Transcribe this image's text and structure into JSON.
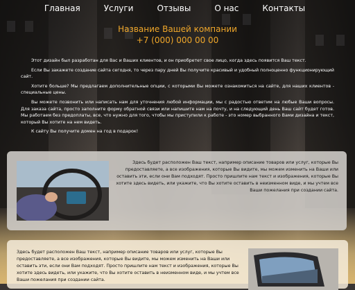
{
  "nav": {
    "items": [
      {
        "label": "Главная"
      },
      {
        "label": "Услуги"
      },
      {
        "label": "Отзывы"
      },
      {
        "label": "О нас"
      },
      {
        "label": "Контакты"
      }
    ]
  },
  "header": {
    "company_name": "Название Вашей компании",
    "phone": "+7 (000) 000 00 00"
  },
  "intro": {
    "paragraphs": [
      "Этот дизайн был разработан для Вас и Ваших клиентов, и он приобретет свое лицо, когда здесь появится Ваш текст.",
      "Если Вы закажете создание сайта сегодня, то через пару дней Вы получите красивый и удобный полноценно функционирующий сайт.",
      "Хотите больше? Мы предлагаем дополнительные опции, с которыми Вы можете ознакомиться на сайте, для наших клиентов - специальные цены.",
      "Вы можете позвонить или написать нам для уточнения любой информации, мы с радостью ответим на любые Ваши вопросы. Для заказа сайта, просто заполните форму обратной связи или напишите нам на почту, и на следующий день Ваш сайт будет готов. Мы работаем без предоплаты, все, что нужно для того, чтобы мы приступили к работе - это номер выбранного Вами дизайна и текст, который Вы хотите на нем видеть.",
      "К сайту Вы получите домен на год в подарок!"
    ]
  },
  "card1": {
    "text": "Здесь будет расположен Ваш текст, например описание товаров или услуг, которые Вы предоставляете, а все изображения, которые Вы видите, мы можем изменить на Ваши или оставить эти, если они Вам подходят. Просто пришлите нам текст и изображения, которые Вы хотите здесь видеть, или укажите, что Вы хотите оставить в неизменном виде, и мы учтем все Ваши пожелания при создании сайта."
  },
  "card2": {
    "text": "Здесь будет расположен Ваш текст, например описание товаров или услуг, которые Вы предоставляете, а все изображения, которые Вы видите, мы можем изменить на Ваши или оставить эти, если они Вам подходят. Просто пришлите нам текст и изображения, которые Вы хотите здесь видеть, или укажите, что Вы хотите оставить в неизменном виде, и мы учтем все Ваши пожелания при создании сайта."
  },
  "colors": {
    "accent": "#f0a72a",
    "nav_text": "#ffffff",
    "card1_bg": "#d2ceca",
    "card2_bg": "#f5ebda"
  }
}
